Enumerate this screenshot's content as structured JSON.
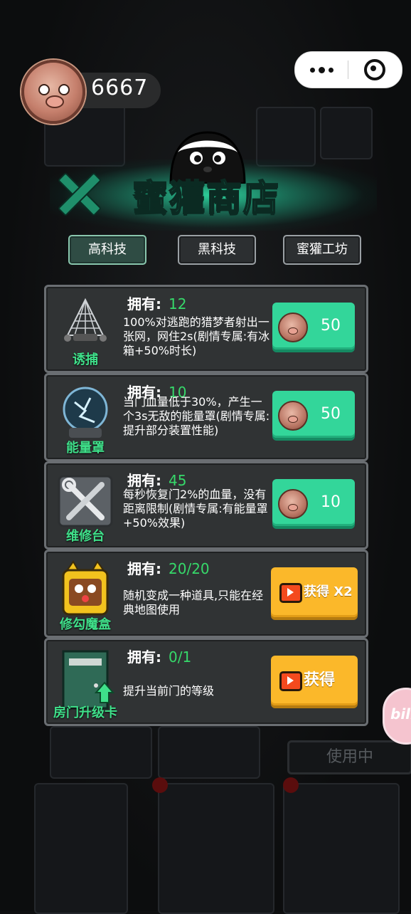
{
  "top_bar": {
    "coins": "6667",
    "avatar_icon": "pig-avatar-icon"
  },
  "mini_program_capsule": {
    "more_icon": "more-dots-icon",
    "close_icon": "target-close-icon"
  },
  "shop": {
    "title": "蜜獾商店",
    "close_icon": "close-x-icon",
    "mascot_icon": "honey-badger-icon",
    "tabs": [
      {
        "label": "高科技",
        "active": true
      },
      {
        "label": "黑科技",
        "active": false
      },
      {
        "label": "蜜獾工坊",
        "active": false
      }
    ],
    "owned_label": "拥有:",
    "items": [
      {
        "name": "诱捕",
        "icon": "net-launcher-icon",
        "owned": "12",
        "desc": "100%对逃跑的猎梦者射出一张网，网住2s(剧情专属:有冰箱+50%时长)",
        "action": "coin",
        "price": "50"
      },
      {
        "name": "能量罩",
        "icon": "energy-orb-icon",
        "owned": "10",
        "desc": "当门血量低于30%，产生一个3s无敌的能量罩(剧情专属:提升部分装置性能)",
        "action": "coin",
        "price": "50"
      },
      {
        "name": "维修台",
        "icon": "wrench-screwdriver-icon",
        "owned": "45",
        "desc": "每秒恢复门2%的血量，没有距离限制(剧情专属:有能量罩+50%效果)",
        "action": "coin",
        "price": "10"
      },
      {
        "name": "修勾魔盒",
        "icon": "dog-magic-box-icon",
        "owned": "20/20",
        "desc": "随机变成一种道具,只能在经典地图使用",
        "action": "ad",
        "button_label": "获得 X2"
      },
      {
        "name": "房门升级卡",
        "icon": "door-upgrade-icon",
        "owned": "0/1",
        "desc": "提升当前门的等级",
        "action": "ad",
        "button_label": "获得"
      }
    ]
  },
  "background": {
    "in_use_label": "使用中",
    "bili_label": "bili"
  },
  "colors": {
    "accent_green": "#33d69a",
    "owned_green": "#36d96a",
    "label_green": "#3fe08a",
    "ad_yellow": "#fbb82a",
    "card_bg": "#303334"
  }
}
